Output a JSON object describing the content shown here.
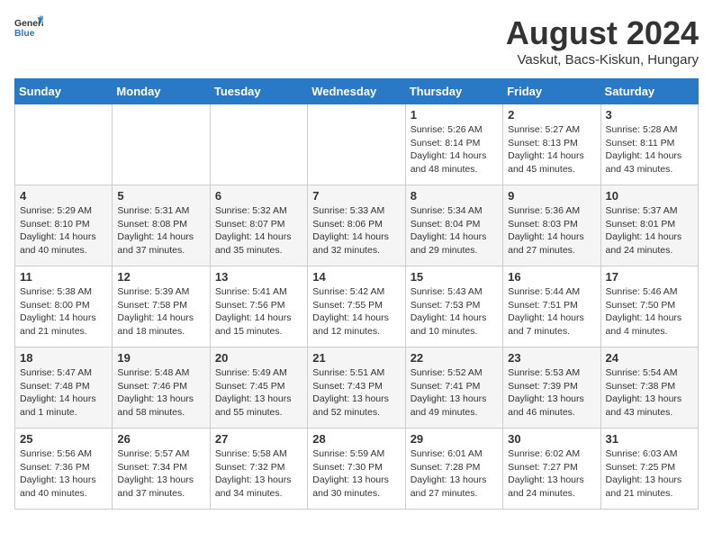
{
  "header": {
    "logo_general": "General",
    "logo_blue": "Blue",
    "title": "August 2024",
    "subtitle": "Vaskut, Bacs-Kiskun, Hungary"
  },
  "days_of_week": [
    "Sunday",
    "Monday",
    "Tuesday",
    "Wednesday",
    "Thursday",
    "Friday",
    "Saturday"
  ],
  "weeks": [
    [
      {
        "day": "",
        "info": ""
      },
      {
        "day": "",
        "info": ""
      },
      {
        "day": "",
        "info": ""
      },
      {
        "day": "",
        "info": ""
      },
      {
        "day": "1",
        "info": "Sunrise: 5:26 AM\nSunset: 8:14 PM\nDaylight: 14 hours\nand 48 minutes."
      },
      {
        "day": "2",
        "info": "Sunrise: 5:27 AM\nSunset: 8:13 PM\nDaylight: 14 hours\nand 45 minutes."
      },
      {
        "day": "3",
        "info": "Sunrise: 5:28 AM\nSunset: 8:11 PM\nDaylight: 14 hours\nand 43 minutes."
      }
    ],
    [
      {
        "day": "4",
        "info": "Sunrise: 5:29 AM\nSunset: 8:10 PM\nDaylight: 14 hours\nand 40 minutes."
      },
      {
        "day": "5",
        "info": "Sunrise: 5:31 AM\nSunset: 8:08 PM\nDaylight: 14 hours\nand 37 minutes."
      },
      {
        "day": "6",
        "info": "Sunrise: 5:32 AM\nSunset: 8:07 PM\nDaylight: 14 hours\nand 35 minutes."
      },
      {
        "day": "7",
        "info": "Sunrise: 5:33 AM\nSunset: 8:06 PM\nDaylight: 14 hours\nand 32 minutes."
      },
      {
        "day": "8",
        "info": "Sunrise: 5:34 AM\nSunset: 8:04 PM\nDaylight: 14 hours\nand 29 minutes."
      },
      {
        "day": "9",
        "info": "Sunrise: 5:36 AM\nSunset: 8:03 PM\nDaylight: 14 hours\nand 27 minutes."
      },
      {
        "day": "10",
        "info": "Sunrise: 5:37 AM\nSunset: 8:01 PM\nDaylight: 14 hours\nand 24 minutes."
      }
    ],
    [
      {
        "day": "11",
        "info": "Sunrise: 5:38 AM\nSunset: 8:00 PM\nDaylight: 14 hours\nand 21 minutes."
      },
      {
        "day": "12",
        "info": "Sunrise: 5:39 AM\nSunset: 7:58 PM\nDaylight: 14 hours\nand 18 minutes."
      },
      {
        "day": "13",
        "info": "Sunrise: 5:41 AM\nSunset: 7:56 PM\nDaylight: 14 hours\nand 15 minutes."
      },
      {
        "day": "14",
        "info": "Sunrise: 5:42 AM\nSunset: 7:55 PM\nDaylight: 14 hours\nand 12 minutes."
      },
      {
        "day": "15",
        "info": "Sunrise: 5:43 AM\nSunset: 7:53 PM\nDaylight: 14 hours\nand 10 minutes."
      },
      {
        "day": "16",
        "info": "Sunrise: 5:44 AM\nSunset: 7:51 PM\nDaylight: 14 hours\nand 7 minutes."
      },
      {
        "day": "17",
        "info": "Sunrise: 5:46 AM\nSunset: 7:50 PM\nDaylight: 14 hours\nand 4 minutes."
      }
    ],
    [
      {
        "day": "18",
        "info": "Sunrise: 5:47 AM\nSunset: 7:48 PM\nDaylight: 14 hours\nand 1 minute."
      },
      {
        "day": "19",
        "info": "Sunrise: 5:48 AM\nSunset: 7:46 PM\nDaylight: 13 hours\nand 58 minutes."
      },
      {
        "day": "20",
        "info": "Sunrise: 5:49 AM\nSunset: 7:45 PM\nDaylight: 13 hours\nand 55 minutes."
      },
      {
        "day": "21",
        "info": "Sunrise: 5:51 AM\nSunset: 7:43 PM\nDaylight: 13 hours\nand 52 minutes."
      },
      {
        "day": "22",
        "info": "Sunrise: 5:52 AM\nSunset: 7:41 PM\nDaylight: 13 hours\nand 49 minutes."
      },
      {
        "day": "23",
        "info": "Sunrise: 5:53 AM\nSunset: 7:39 PM\nDaylight: 13 hours\nand 46 minutes."
      },
      {
        "day": "24",
        "info": "Sunrise: 5:54 AM\nSunset: 7:38 PM\nDaylight: 13 hours\nand 43 minutes."
      }
    ],
    [
      {
        "day": "25",
        "info": "Sunrise: 5:56 AM\nSunset: 7:36 PM\nDaylight: 13 hours\nand 40 minutes."
      },
      {
        "day": "26",
        "info": "Sunrise: 5:57 AM\nSunset: 7:34 PM\nDaylight: 13 hours\nand 37 minutes."
      },
      {
        "day": "27",
        "info": "Sunrise: 5:58 AM\nSunset: 7:32 PM\nDaylight: 13 hours\nand 34 minutes."
      },
      {
        "day": "28",
        "info": "Sunrise: 5:59 AM\nSunset: 7:30 PM\nDaylight: 13 hours\nand 30 minutes."
      },
      {
        "day": "29",
        "info": "Sunrise: 6:01 AM\nSunset: 7:28 PM\nDaylight: 13 hours\nand 27 minutes."
      },
      {
        "day": "30",
        "info": "Sunrise: 6:02 AM\nSunset: 7:27 PM\nDaylight: 13 hours\nand 24 minutes."
      },
      {
        "day": "31",
        "info": "Sunrise: 6:03 AM\nSunset: 7:25 PM\nDaylight: 13 hours\nand 21 minutes."
      }
    ]
  ]
}
